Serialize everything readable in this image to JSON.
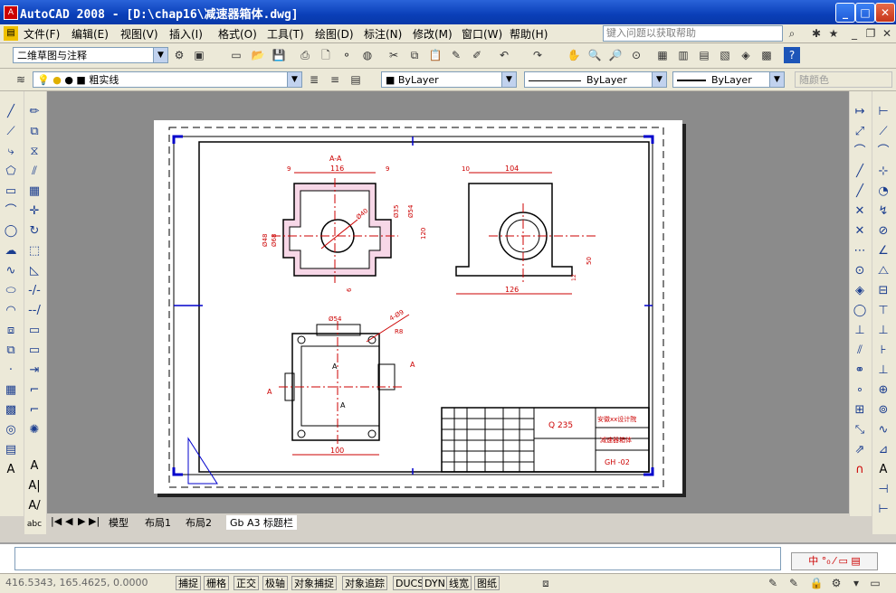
{
  "window": {
    "title": "AutoCAD 2008 - [D:\\chap16\\减速器箱体.dwg]"
  },
  "menu": {
    "items": [
      "文件(F)",
      "编辑(E)",
      "视图(V)",
      "插入(I)",
      "格式(O)",
      "工具(T)",
      "绘图(D)",
      "标注(N)",
      "修改(M)",
      "窗口(W)",
      "帮助(H)"
    ],
    "help_placeholder": "键入问题以获取帮助"
  },
  "toolbar1": {
    "workspace": "二维草图与注释"
  },
  "toolbar2": {
    "layer": "粗实线",
    "color": "ByLayer",
    "linetype": "ByLayer",
    "lineweight": "ByLayer",
    "plotstyle": "随颜色"
  },
  "tabs": {
    "items": [
      "模型",
      "布局1",
      "布局2",
      "Gb A3 标题栏"
    ]
  },
  "status": {
    "coords": "416.5343,  165.4625, 0.0000",
    "buttons": [
      "捕捉",
      "栅格",
      "正交",
      "极轴",
      "对象捕捉",
      "对象追踪",
      "DUCS",
      "DYN",
      "线宽",
      "图纸"
    ]
  },
  "drawing": {
    "section_label": "A-A",
    "dims": {
      "top_width": "116",
      "left_9": "9",
      "right_9": "9",
      "dia40": "Ø40",
      "dia35": "Ø35",
      "dia54": "Ø54",
      "dia68": "Ø68",
      "dia48": "Ø48",
      "h120": "120",
      "b6": "6",
      "side_10": "10",
      "side_104": "104",
      "side_126": "126",
      "side_50": "50",
      "side_12": "12",
      "plan_54": "Ø54",
      "plan_holes": "4-Ø9",
      "plan_r": "R8",
      "plan_100": "100",
      "plan_A": "A"
    },
    "titleblock": {
      "material": "Q 235",
      "company": "安徽xx设计院",
      "name": "减速器箱体",
      "code": "GH -02"
    }
  }
}
